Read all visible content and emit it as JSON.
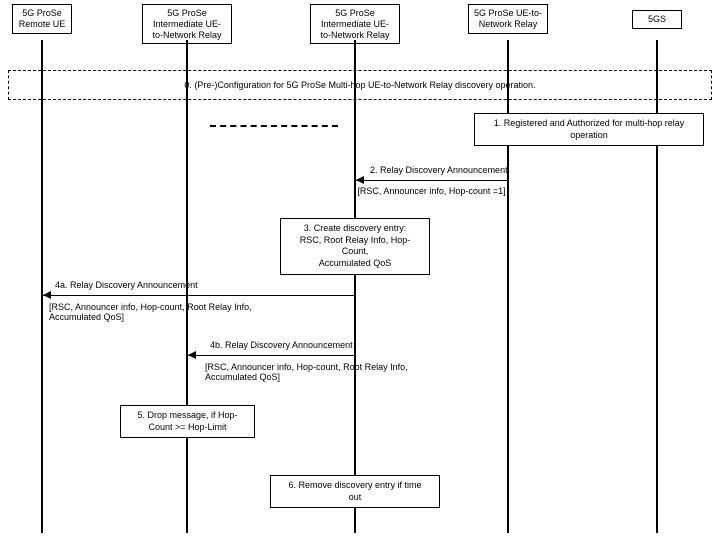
{
  "participants": {
    "p1": "5G ProSe\nRemote UE",
    "p2": "5G ProSe\nIntermediate UE-\nto-Network Relay",
    "p3": "5G ProSe\nIntermediate UE-\nto-Network Relay",
    "p4": "5G ProSe UE-to-\nNetwork Relay",
    "p5": "5GS"
  },
  "steps": {
    "s0": "0. (Pre-)Configuration for 5G ProSe Multi-hop UE-to-Network Relay discovery operation.",
    "s1": "1. Registered and Authorized for multi-hop relay operation",
    "s2_label": "2. Relay Discovery Announcement",
    "s2_bracket": "[RSC, Announcer info, Hop-count =1]",
    "s3": "3. Create discovery entry:\nRSC, Root Relay Info, Hop-Count,\nAccumulated QoS",
    "s4a_label": "4a. Relay Discovery Announcement",
    "s4a_bracket": "[RSC, Announcer info, Hop-count, Root Relay Info,\nAccumulated QoS]",
    "s4b_label": "4b. Relay Discovery Announcement",
    "s4b_bracket": "[RSC, Announcer info, Hop-count, Root Relay Info,\nAccumulated QoS]",
    "s5": "5. Drop message, if Hop-\nCount >= Hop-Limit",
    "s6": "6. Remove discovery entry if time\nout"
  }
}
